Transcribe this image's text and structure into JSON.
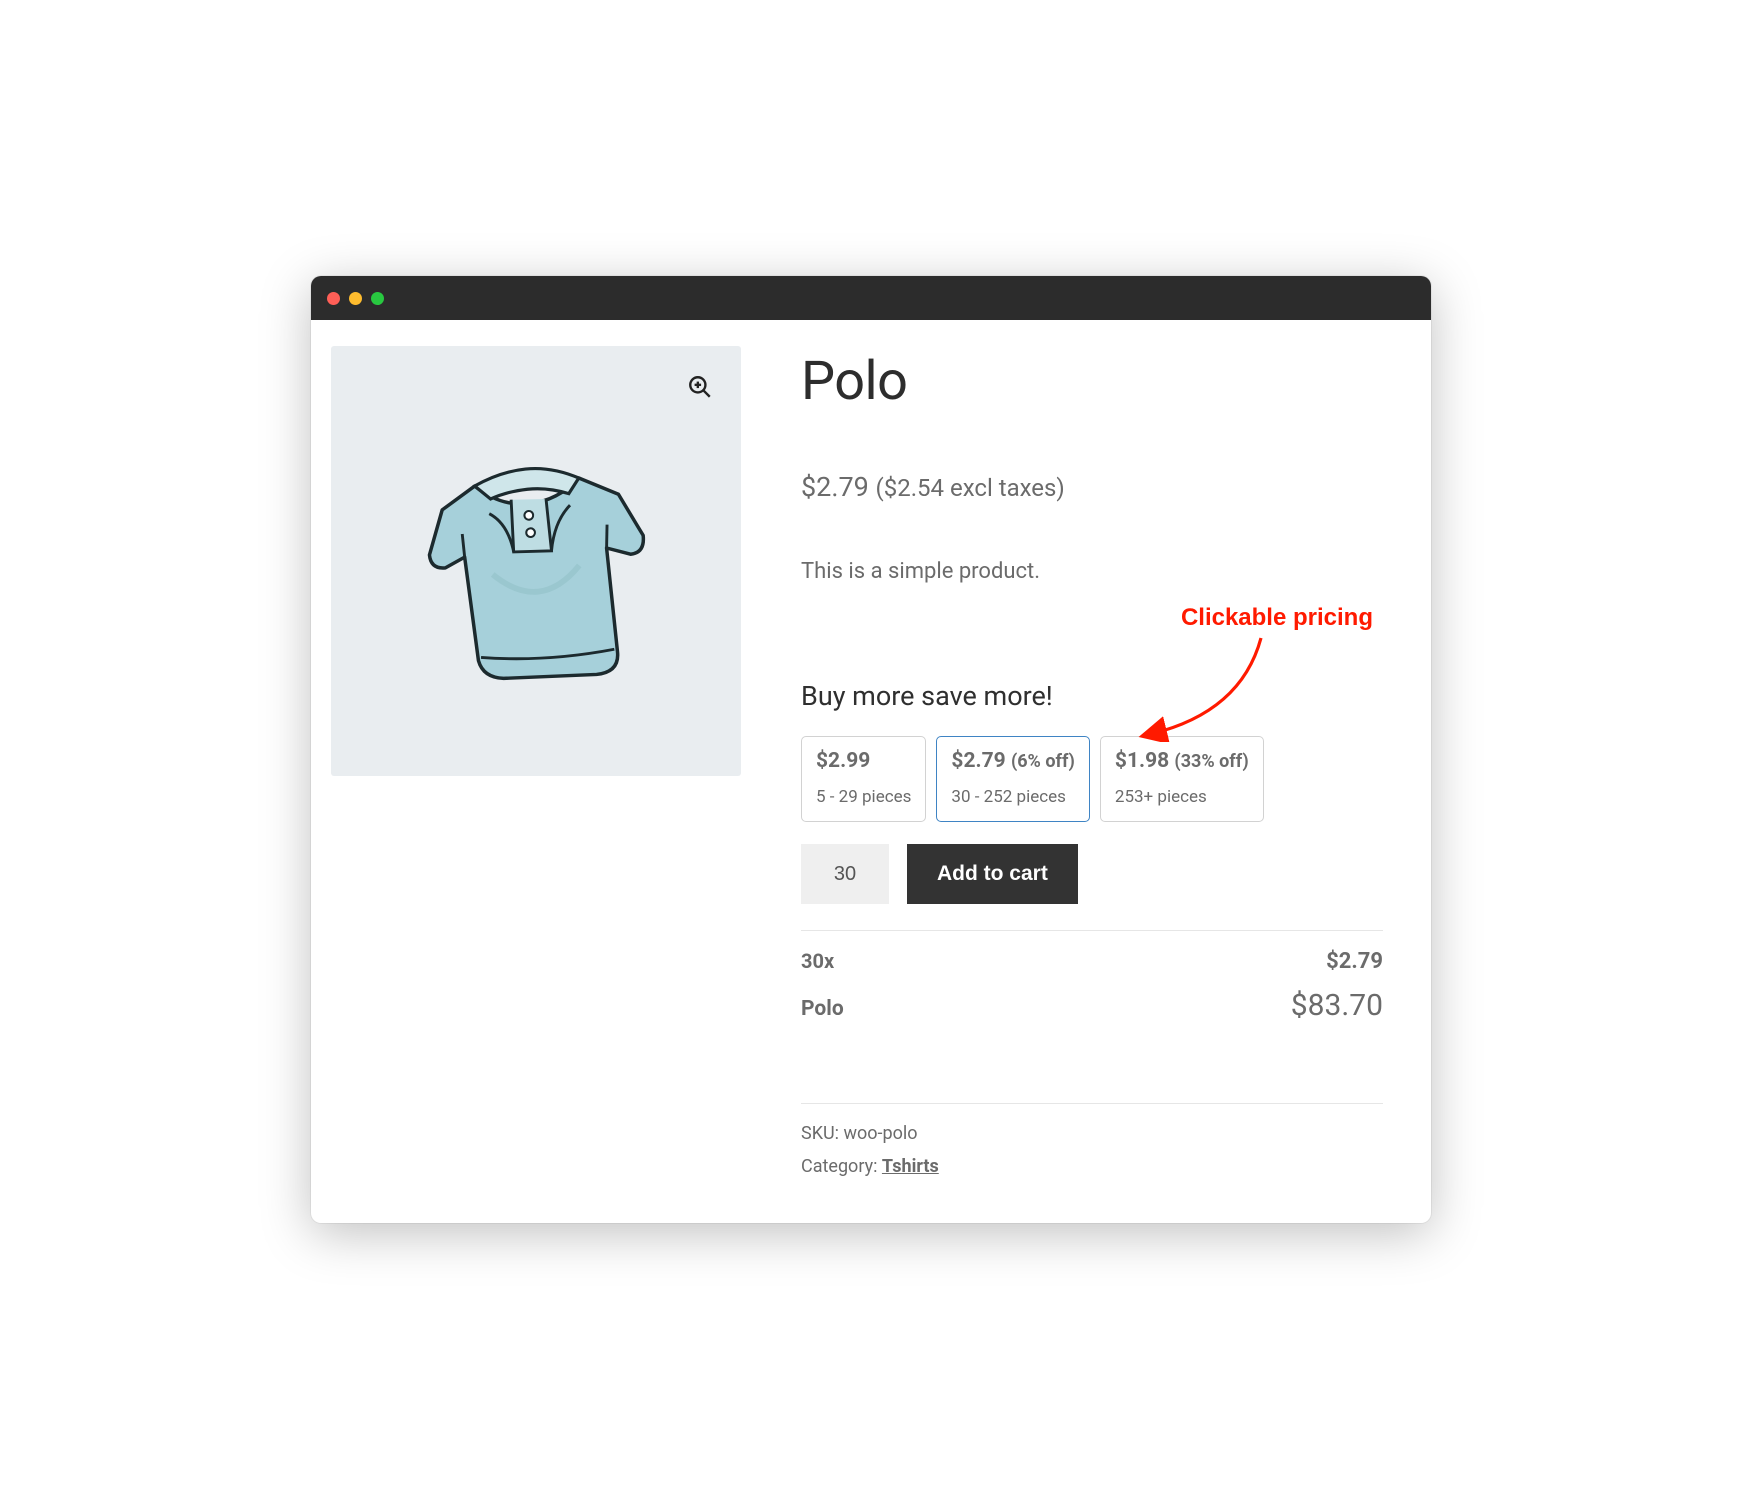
{
  "product": {
    "title": "Polo",
    "price": "$2.79",
    "price_excl_taxes": "($2.54 excl taxes)",
    "description": "This is a simple product."
  },
  "tiers": {
    "heading": "Buy more save more!",
    "items": [
      {
        "price": "$2.99",
        "off": "",
        "range": "5 - 29 pieces",
        "selected": false
      },
      {
        "price": "$2.79",
        "off": "(6% off)",
        "range": "30 - 252 pieces",
        "selected": true
      },
      {
        "price": "$1.98",
        "off": "(33% off)",
        "range": "253+ pieces",
        "selected": false
      }
    ]
  },
  "cart": {
    "quantity": "30",
    "add_label": "Add to cart"
  },
  "summary": {
    "qty_label": "30x",
    "unit_price": "$2.79",
    "name": "Polo",
    "total": "$83.70"
  },
  "meta": {
    "sku_label": "SKU:",
    "sku_value": "woo-polo",
    "category_label": "Category:",
    "category_value": "Tshirts"
  },
  "annotation": {
    "label": "Clickable pricing"
  }
}
